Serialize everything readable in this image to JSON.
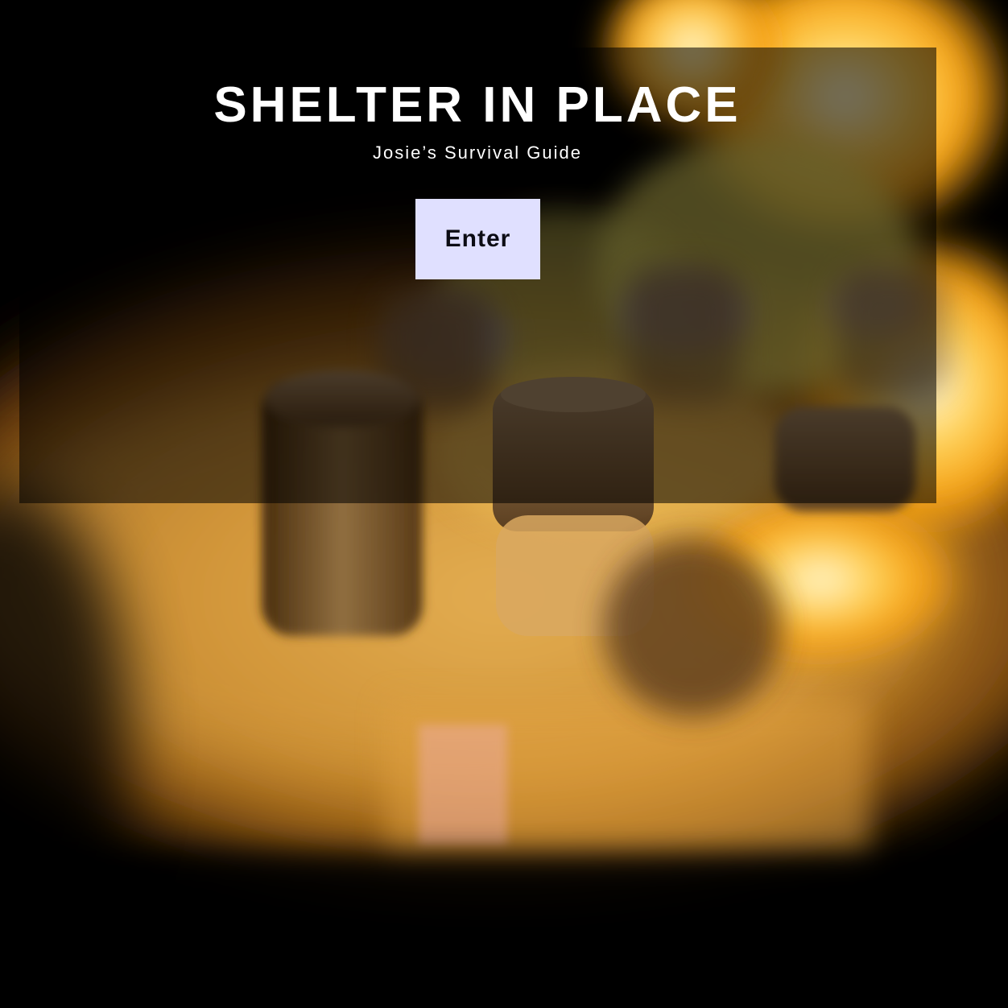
{
  "hero": {
    "title": "SHELTER IN PLACE",
    "subtitle": "Josie’s Survival Guide",
    "enter_label": "Enter"
  },
  "background": {
    "subject": "roasting-marshmallows-fire-photo",
    "colors": {
      "flame": "#ffb020",
      "flame_core": "#fff4c0",
      "marshmallow": "#9a7a50",
      "dark": "#000000"
    }
  },
  "colors": {
    "panel_overlay": "rgba(0,0,0,0.55)",
    "button_bg": "#e0e0ff",
    "button_text": "#0c0c14",
    "title_text": "#ffffff"
  }
}
